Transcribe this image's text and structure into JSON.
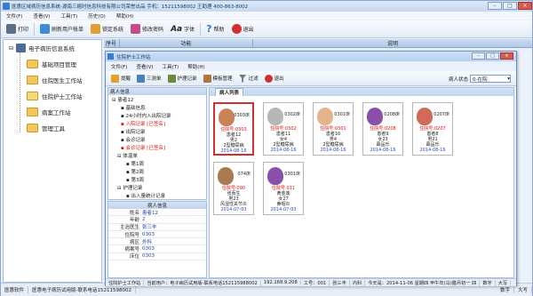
{
  "app": {
    "title": "医惠区域病历信息系统-湖南三嬉时信息科技有限公司荣誉出品 手机：15211598002 王助理 400-863-8002"
  },
  "menu": [
    "文件(F)",
    "查看(V)",
    "工具(T)",
    "历史(O)",
    "帮助(H)"
  ],
  "toolbar": [
    {
      "label": "打印",
      "icon": "printer-icon",
      "color": "#5d6e8a"
    },
    {
      "label": "刷新用户帐单",
      "icon": "refresh-icon",
      "color": "#3f8bd8"
    },
    {
      "label": "锁定系统",
      "icon": "lock-icon",
      "color": "#e0a12e"
    },
    {
      "label": "修改密码",
      "icon": "key-icon",
      "color": "#c64b8c"
    },
    {
      "label": "字体",
      "icon": "font-icon",
      "color": "#333333"
    },
    {
      "label": "帮助",
      "icon": "help-icon",
      "color": "#3a7bd5"
    },
    {
      "label": "退出",
      "icon": "exit-icon",
      "color": "#d13030"
    }
  ],
  "left_tree": {
    "root": "电子病历信息系统",
    "items": [
      "基础项目管理",
      "住院医生工作站",
      "住院护士工作站",
      "病案工作站",
      "管理工具"
    ]
  },
  "main_header": {
    "col1": "序号",
    "col2": "功能",
    "col3": "说明"
  },
  "child": {
    "title": "住院护士工作站",
    "menu": [
      "文件(F)",
      "查看(V)",
      "工具(T)",
      "帮助(H)"
    ],
    "toolbar": [
      "提醒",
      "三测单",
      "护理记录",
      "模板管理",
      "过滤",
      "退出"
    ],
    "state_label": "病人状态",
    "state_value": "0-在院",
    "tree_label": "病人信息",
    "tree": [
      {
        "t": "患者12",
        "c": ""
      },
      {
        "t": "基础信息",
        "c": ""
      },
      {
        "t": "24小时内入出院记录",
        "c": ""
      },
      {
        "t": "入院记录 [已签名]",
        "c": "red"
      },
      {
        "t": "出院记录",
        "c": ""
      },
      {
        "t": "会诊记录",
        "c": ""
      },
      {
        "t": "会诊记录 [已签名]",
        "c": "red"
      },
      {
        "t": "体温单",
        "c": ""
      },
      {
        "t": "第1周",
        "c": ""
      },
      {
        "t": "第2周",
        "c": ""
      },
      {
        "t": "第3周",
        "c": ""
      },
      {
        "t": "护理记录",
        "c": ""
      },
      {
        "t": "出入量统计记录",
        "c": ""
      }
    ],
    "info_label": "病人信息",
    "info": [
      {
        "k": "姓名",
        "v": "患者12"
      },
      {
        "k": "年龄",
        "v": "2"
      },
      {
        "k": "主治医生",
        "v": "张三丰"
      },
      {
        "k": "住院号",
        "v": "0303"
      },
      {
        "k": "病区",
        "v": "外科"
      },
      {
        "k": "病案号",
        "v": "0303"
      },
      {
        "k": "床位",
        "v": "0303"
      }
    ],
    "list_tab": "病人列表",
    "patients": [
      {
        "bed": "0303床",
        "id": "住院号:0303",
        "name": "患者12",
        "age": "男2",
        "diag": "2型糖尿病",
        "date": "2014-08-16",
        "face": "#c9835a"
      },
      {
        "bed": "0302床",
        "id": "住院号:0302",
        "name": "患者11",
        "age": "女4",
        "diag": "2型糖尿病",
        "date": "2014-08-16",
        "face": "#b7b7b7"
      },
      {
        "bed": "0301床",
        "id": "住院号:0301",
        "name": "患者10",
        "age": "男4",
        "diag": "2型糖尿病",
        "date": "2014-08-16",
        "face": "#e4b48c"
      },
      {
        "bed": "0208床",
        "id": "住院号:0208",
        "name": "患者9",
        "age": "女23",
        "diag": "幕品乐",
        "date": "2014-08-16",
        "face": "#8a4fa8"
      },
      {
        "bed": "0207床",
        "id": "住院号:0207",
        "name": "患者8",
        "age": "男21",
        "diag": "幕品乐",
        "date": "2014-08-16",
        "face": "#d06a5a"
      },
      {
        "bed": "074床",
        "id": "住院号:090",
        "name": "张而生",
        "age": "男23",
        "diag": "风湿性关节炎",
        "date": "2014-07-03",
        "face": "#a9794f"
      },
      {
        "bed": "0301床",
        "id": "住院号:011",
        "name": "黄金莲",
        "age": "女27",
        "diag": "鼻咽炎",
        "date": "2014-07-03",
        "face": "#8a4fa8"
      }
    ],
    "status": [
      "住院护士工作站",
      "当前用户：电子病历试用版-联系电话152115988002",
      "192.168.9.208",
      "工号：001",
      "张三丰",
      "内科",
      "今天是：2014-11-06 星期四 甲午年(马)腊月初一 四",
      "数字",
      "大写"
    ]
  },
  "statusbar": [
    "医惠软件",
    "医惠电子病历试用版-联系电话15211598002",
    "数字",
    "大写"
  ]
}
